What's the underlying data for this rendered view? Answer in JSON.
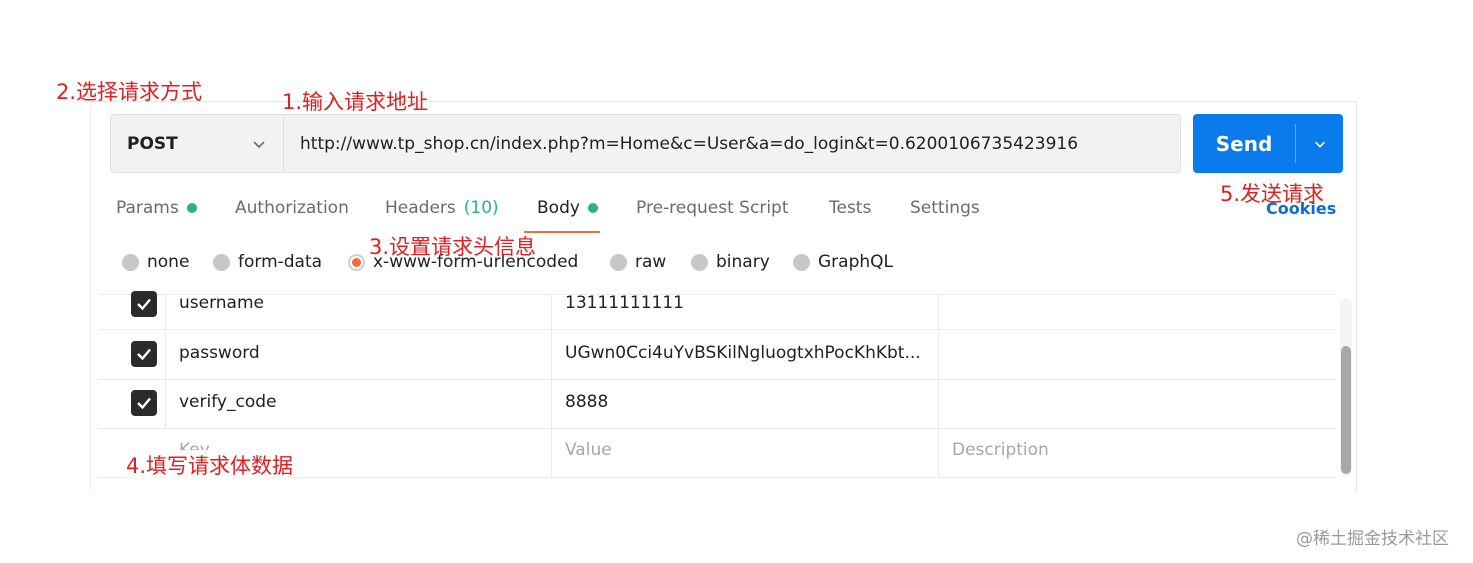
{
  "request": {
    "method": "POST",
    "url": "http://www.tp_shop.cn/index.php?m=Home&c=User&a=do_login&t=0.6200106735423916",
    "send_label": "Send"
  },
  "tabs": [
    {
      "label": "Params",
      "dot": true
    },
    {
      "label": "Authorization"
    },
    {
      "label": "Headers",
      "count": "(10)"
    },
    {
      "label": "Body",
      "dot": true,
      "active": true
    },
    {
      "label": "Pre-request Script"
    },
    {
      "label": "Tests"
    },
    {
      "label": "Settings"
    }
  ],
  "cookies_label": "Cookies",
  "body_types": [
    {
      "label": "none"
    },
    {
      "label": "form-data"
    },
    {
      "label": "x-www-form-urlencoded",
      "selected": true
    },
    {
      "label": "raw"
    },
    {
      "label": "binary"
    },
    {
      "label": "GraphQL"
    }
  ],
  "params_table": {
    "rows": [
      {
        "checked": true,
        "key": "username",
        "value": "13111111111",
        "description": ""
      },
      {
        "checked": true,
        "key": "password",
        "value": "UGwn0Cci4uYvBSKilNgluogtxhPocKhKbt...",
        "description": ""
      },
      {
        "checked": true,
        "key": "verify_code",
        "value": "8888",
        "description": ""
      }
    ],
    "placeholders": {
      "key": "Key",
      "value": "Value",
      "description": "Description"
    }
  },
  "annotations": {
    "step1": "1.输入请求地址",
    "step2": "2.选择请求方式",
    "step3": "3.设置请求头信息",
    "step4": "4.填写请求体数据",
    "step5": "5.发送请求"
  },
  "watermark": "@稀土掘金技术社区",
  "colors": {
    "accent": "#097bed",
    "active_tab_underline": "#f26b3a",
    "status_dot": "#26b47f",
    "annotation": "#e02020"
  }
}
